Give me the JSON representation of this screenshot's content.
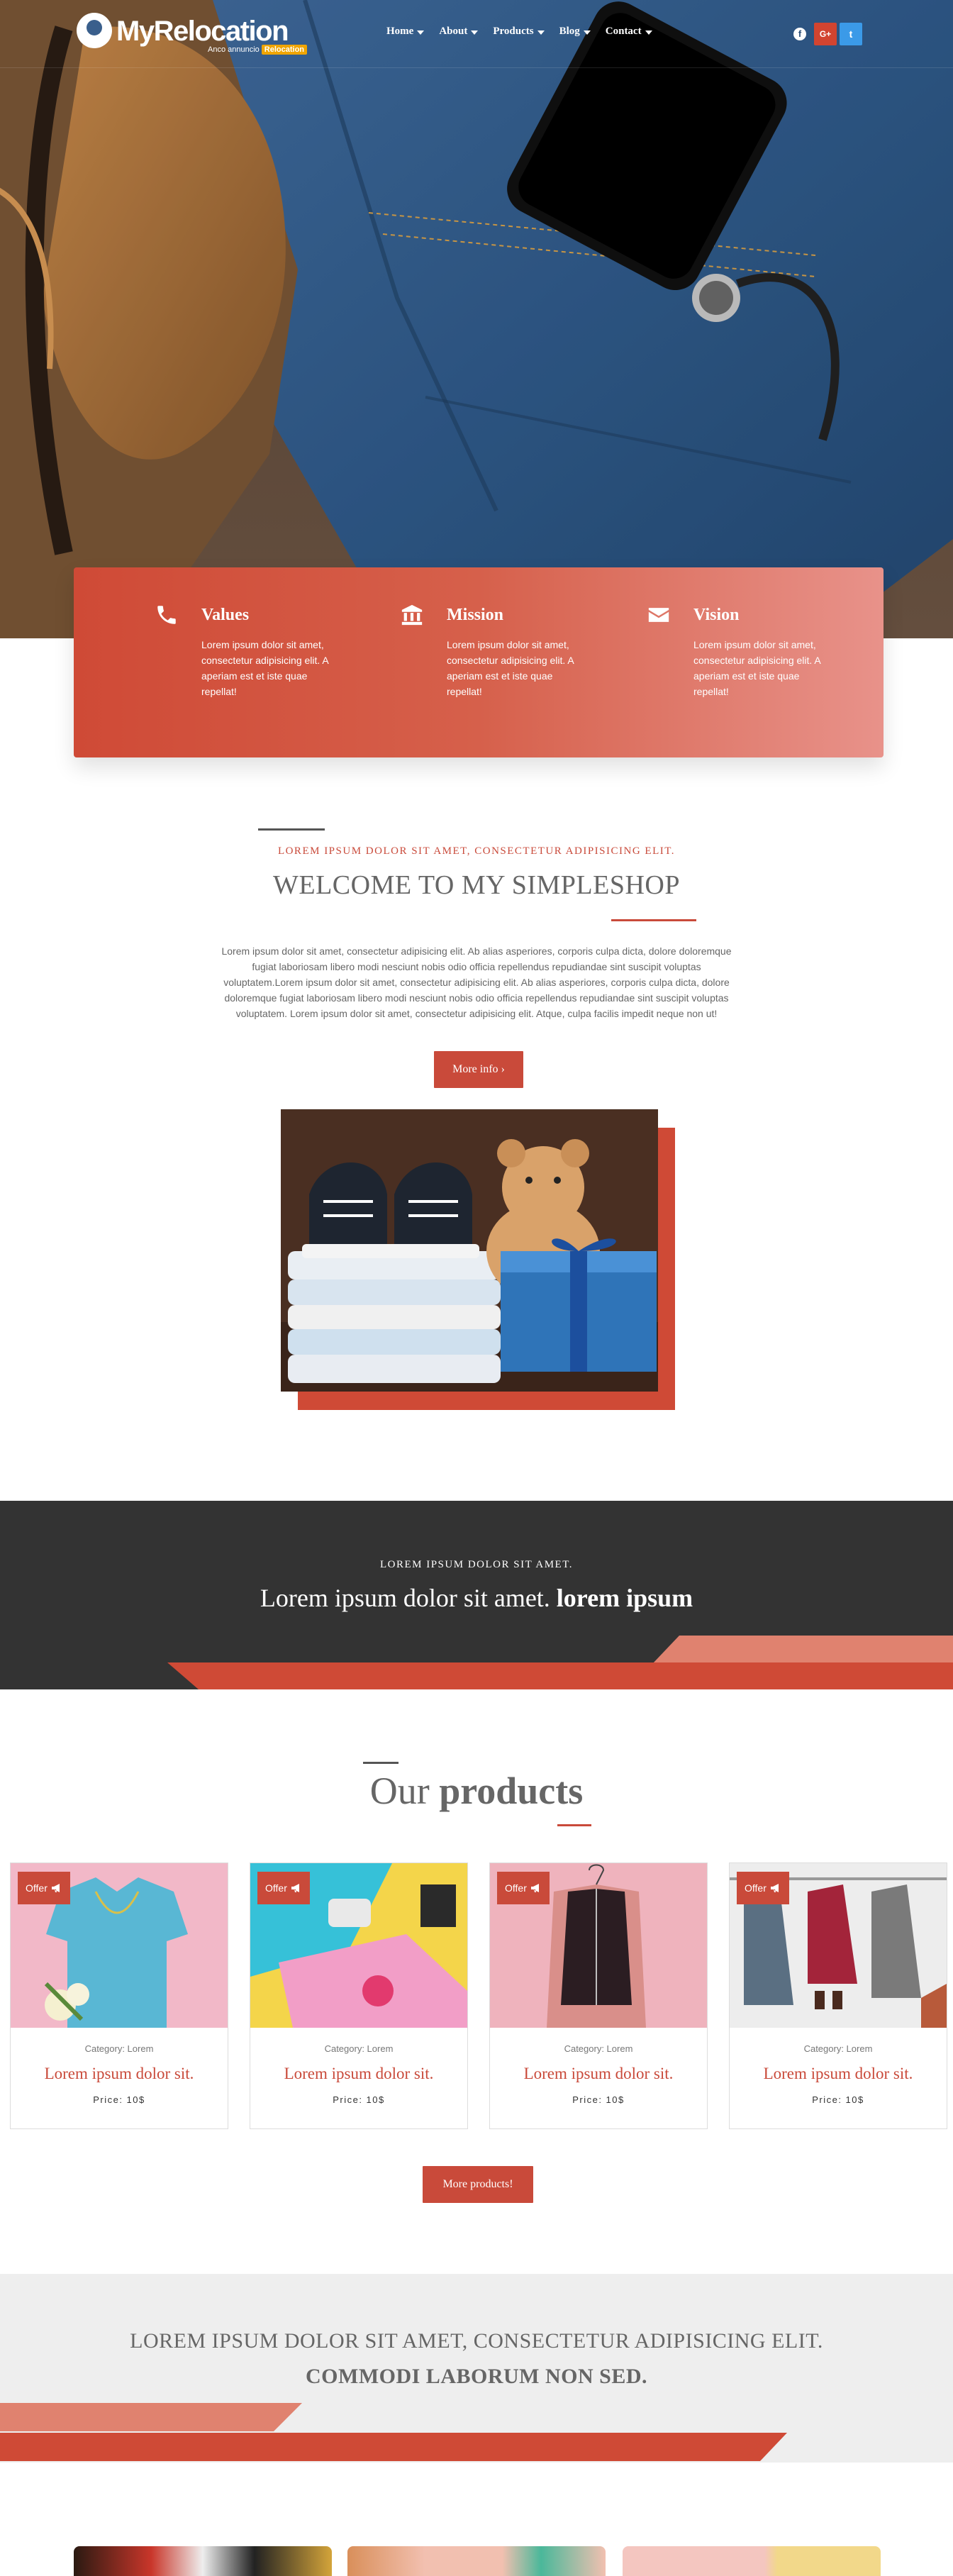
{
  "brand": {
    "name": "MyRelocation",
    "tagline_prefix": "Anco annuncio",
    "tagline_badge": "Relocation"
  },
  "nav": {
    "items": [
      {
        "label": "Home"
      },
      {
        "label": "About"
      },
      {
        "label": "Products"
      },
      {
        "label": "Blog"
      },
      {
        "label": "Contact"
      }
    ]
  },
  "socials": {
    "facebook_icon": "f",
    "googleplus_icon": "G+",
    "twitter_icon": "t"
  },
  "features": [
    {
      "icon": "phone-icon",
      "title": "Values",
      "text": "Lorem ipsum dolor sit amet, consectetur adipisicing elit. A aperiam est et iste quae repellat!"
    },
    {
      "icon": "bank-icon",
      "title": "Mission",
      "text": "Lorem ipsum dolor sit amet, consectetur adipisicing elit. A aperiam est et iste quae repellat!"
    },
    {
      "icon": "envelope-icon",
      "title": "Vision",
      "text": "Lorem ipsum dolor sit amet, consectetur adipisicing elit. A aperiam est et iste quae repellat!"
    }
  ],
  "welcome": {
    "kicker": "LOREM IPSUM DOLOR SIT AMET, CONSECTETUR ADIPISICING ELIT.",
    "title": "WELCOME TO MY SIMPLESHOP",
    "body": "Lorem ipsum dolor sit amet, consectetur adipisicing elit. Ab alias asperiores, corporis culpa dicta, dolore doloremque fugiat laboriosam libero modi nesciunt nobis odio officia repellendus repudiandae sint suscipit voluptas voluptatem.Lorem ipsum dolor sit amet, consectetur adipisicing elit. Ab alias asperiores, corporis culpa dicta, dolore doloremque fugiat laboriosam libero modi nesciunt nobis odio officia repellendus repudiandae sint suscipit voluptas voluptatem. Lorem ipsum dolor sit amet, consectetur adipisicing elit. Atque, culpa facilis impedit neque non ut!",
    "button": "More info ›"
  },
  "banner": {
    "kicker": "LOREM IPSUM DOLOR SIT AMET.",
    "title_plain": "Lorem ipsum dolor sit amet. ",
    "title_bold": "lorem ipsum"
  },
  "products": {
    "title_plain": "Our ",
    "title_bold": "products",
    "offer_label": "Offer",
    "items": [
      {
        "category": "Category: Lorem",
        "name": "Lorem ipsum dolor sit.",
        "price": "Price: 10$"
      },
      {
        "category": "Category: Lorem",
        "name": "Lorem ipsum dolor sit.",
        "price": "Price: 10$"
      },
      {
        "category": "Category: Lorem",
        "name": "Lorem ipsum dolor sit.",
        "price": "Price: 10$"
      },
      {
        "category": "Category: Lorem",
        "name": "Lorem ipsum dolor sit.",
        "price": "Price: 10$"
      }
    ],
    "button": "More products!"
  },
  "cta": {
    "line1": "LOREM IPSUM DOLOR SIT AMET, CONSECTETUR ADIPISICING ELIT.",
    "line2": "COMMODI LABORUM NON SED."
  },
  "colors": {
    "accent": "#c94a3a",
    "accent_light": "#e8928a",
    "dark_band": "#333333",
    "grey_band": "#eeeeee",
    "denim": "#2c4f78"
  }
}
